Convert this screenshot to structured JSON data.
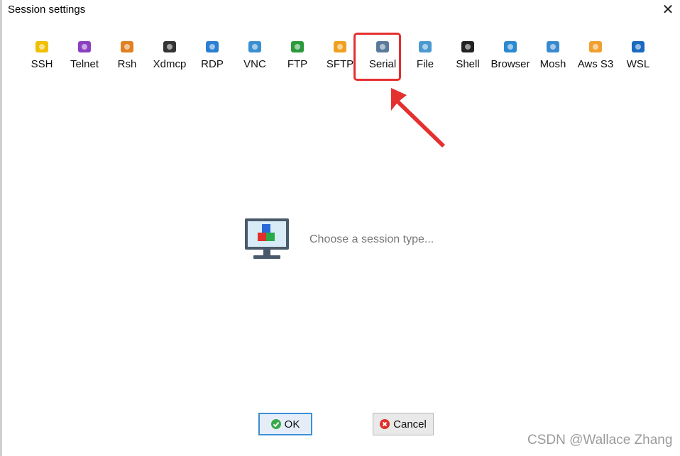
{
  "window": {
    "title": "Session settings",
    "close_glyph": "✕"
  },
  "session_types": [
    {
      "label": "SSH",
      "icon": "ssh-icon",
      "color": "#f0c000"
    },
    {
      "label": "Telnet",
      "icon": "telnet-icon",
      "color": "#8a40c0"
    },
    {
      "label": "Rsh",
      "icon": "rsh-icon",
      "color": "#e08020"
    },
    {
      "label": "Xdmcp",
      "icon": "xdmcp-icon",
      "color": "#333333"
    },
    {
      "label": "RDP",
      "icon": "rdp-icon",
      "color": "#2a7fd0"
    },
    {
      "label": "VNC",
      "icon": "vnc-icon",
      "color": "#3a8fd0"
    },
    {
      "label": "FTP",
      "icon": "ftp-icon",
      "color": "#2a9a3a"
    },
    {
      "label": "SFTP",
      "icon": "sftp-icon",
      "color": "#f0a020"
    },
    {
      "label": "Serial",
      "icon": "serial-icon",
      "color": "#5a7a9a"
    },
    {
      "label": "File",
      "icon": "file-icon",
      "color": "#4a9ad0"
    },
    {
      "label": "Shell",
      "icon": "shell-icon",
      "color": "#222222"
    },
    {
      "label": "Browser",
      "icon": "browser-icon",
      "color": "#2a8ad0"
    },
    {
      "label": "Mosh",
      "icon": "mosh-icon",
      "color": "#3a8ad0"
    },
    {
      "label": "Aws S3",
      "icon": "aws-s3-icon",
      "color": "#f0a030"
    },
    {
      "label": "WSL",
      "icon": "wsl-icon",
      "color": "#1a6ac0"
    }
  ],
  "highlighted": "Serial",
  "main": {
    "prompt": "Choose a session type..."
  },
  "buttons": {
    "ok": "OK",
    "cancel": "Cancel"
  },
  "watermark": "CSDN @Wallace Zhang",
  "colors": {
    "highlight": "#e53030",
    "ok_border": "#3c8fd6"
  }
}
